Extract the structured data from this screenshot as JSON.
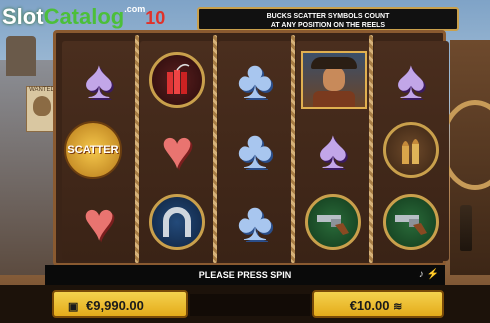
{
  "logo": {
    "part1": "Slot",
    "part2": "Catalog",
    "com": ".com",
    "ten": "10"
  },
  "info": {
    "line1": "BUCKS SCATTER SYMBOLS COUNT",
    "line2": "AT ANY POSITION ON THE REELS"
  },
  "poster": {
    "text": "WANTED"
  },
  "reels": [
    [
      "spade",
      "dynamite",
      "badge"
    ],
    [
      "heart",
      "horseshoe"
    ],
    [
      "club",
      "club",
      "club"
    ],
    [
      "cowboy",
      "spade",
      "gun"
    ],
    [
      "spade",
      "bullets",
      "gun"
    ]
  ],
  "scatter": {
    "label": "SCATTER"
  },
  "message": {
    "text": "PLEASE PRESS SPIN",
    "icon1": "music-icon",
    "icon2": "lightning-icon"
  },
  "balance": {
    "value": "€9,990.00",
    "icon": "wallet-icon"
  },
  "bet": {
    "value": "€10.00",
    "icon": "coins-icon"
  }
}
